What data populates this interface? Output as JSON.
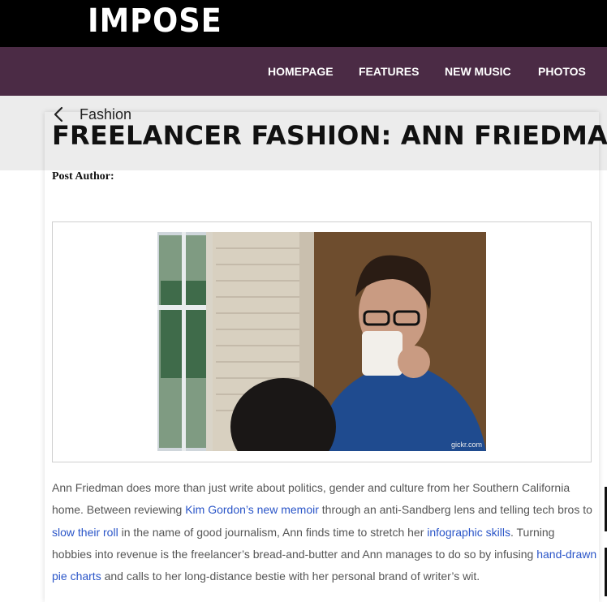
{
  "site": {
    "logo": "IMPOSE"
  },
  "nav": {
    "items": [
      {
        "label": "HOMEPAGE"
      },
      {
        "label": "FEATURES"
      },
      {
        "label": "NEW MUSIC"
      },
      {
        "label": "PHOTOS"
      }
    ]
  },
  "breadcrumb": {
    "label": "Fashion"
  },
  "post": {
    "title": "FREELANCER FASHION: ANN FRIEDMAN",
    "author_label": "Post Author:",
    "image_credit": "gickr.com",
    "body": {
      "t1": "Ann Friedman does more than just write about politics, gender and culture from her Southern California home. Between reviewing ",
      "l1": "Kim Gordon’s new memoir",
      "t2": " through an anti-Sandberg lens and telling tech bros to ",
      "l2": "slow their roll",
      "t3": " in the name of good journalism, Ann finds time to stretch her ",
      "l3": "infographic skills",
      "t4": ". Turning hobbies into revenue is the freelancer’s bread-and-butter and Ann manages to do so by infusing ",
      "l4": "hand-drawn pie charts",
      "t5": " and calls to her long-distance bestie with her personal brand of writer’s wit."
    }
  },
  "colors": {
    "nav_bg": "#4b2b45",
    "link": "#2a55c8",
    "topbar_bg": "#000000"
  }
}
